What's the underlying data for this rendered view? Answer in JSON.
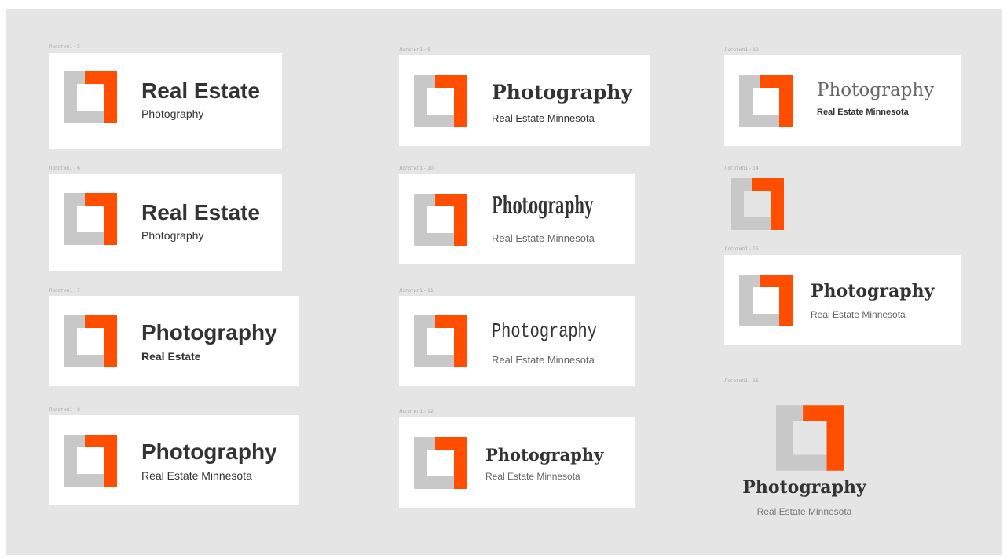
{
  "colors": {
    "accent": "#ff4e00",
    "mark_grey": "#c8c8c8",
    "text_dark": "#333333",
    "canvas_bg": "#e5e5e5"
  },
  "logos": [
    {
      "frame_label": "Логотип1 - 5",
      "title": "Real Estate",
      "subtitle": "Photography"
    },
    {
      "frame_label": "Логотип1 - 6",
      "title": "Real Estate",
      "subtitle": "Photography"
    },
    {
      "frame_label": "Логотип1 - 7",
      "title": "Photography",
      "subtitle": "Real Estate"
    },
    {
      "frame_label": "Логотип1 - 8",
      "title": "Photography",
      "subtitle": "Real Estate Minnesota"
    },
    {
      "frame_label": "Логотип1 - 9",
      "title": "Photography",
      "subtitle": "Real Estate Minnesota"
    },
    {
      "frame_label": "Логотип1 - 10",
      "title": "Photography",
      "subtitle": "Real Estate Minnesota"
    },
    {
      "frame_label": "Логотип1 - 11",
      "title": "Photography",
      "subtitle": "Real Estate Minnesota"
    },
    {
      "frame_label": "Логотип1 - 12",
      "title": "Photography",
      "subtitle": "Real Estate Minnesota"
    },
    {
      "frame_label": "Логотип1 - 13",
      "title": "Photography",
      "subtitle": "Real Estate Minnesota"
    },
    {
      "frame_label": "Логотип1 - 14"
    },
    {
      "frame_label": "Логотип1 - 15",
      "title": "Photography",
      "subtitle": "Real Estate Minnesota"
    },
    {
      "frame_label": "Логотип1 - 16",
      "title": "Photography",
      "subtitle": "Real Estate Minnesota"
    }
  ]
}
